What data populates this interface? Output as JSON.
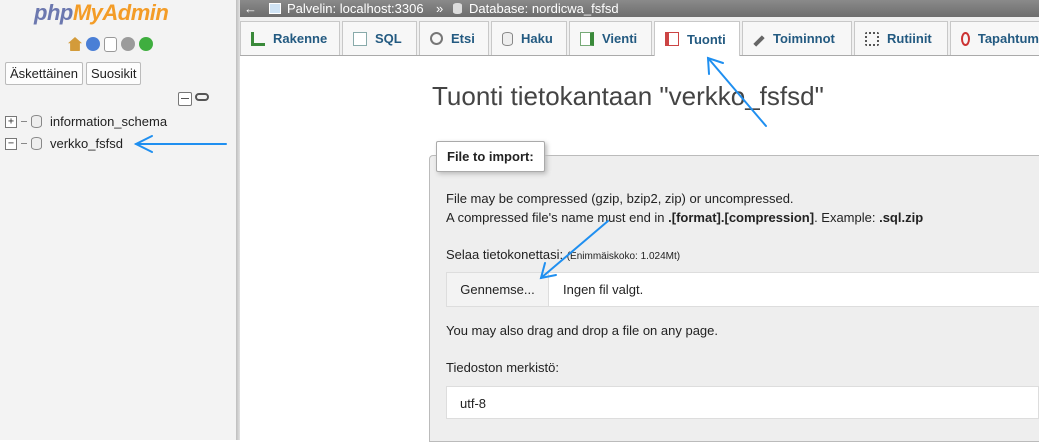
{
  "sidebar": {
    "logo_php": "php",
    "logo_myadmin": "MyAdmin",
    "quick_icons": [
      "home-icon",
      "help-icon",
      "docs-icon",
      "settings-icon",
      "reload-icon"
    ],
    "tabs": [
      {
        "label": "Äskettäinen"
      },
      {
        "label": "Suosikit"
      }
    ],
    "databases": [
      {
        "name": "information_schema",
        "expander": "+"
      },
      {
        "name": "verkko_fsfsd",
        "expander": "−"
      }
    ]
  },
  "topbar": {
    "back_arrow": "←",
    "server": "Palvelin: localhost:3306",
    "separator": "»",
    "database": "Database: nordicwa_fsfsd"
  },
  "tabs": [
    {
      "label": "Rakenne",
      "icon": "structure-icon"
    },
    {
      "label": "SQL",
      "icon": "sql-icon"
    },
    {
      "label": "Etsi",
      "icon": "search-icon"
    },
    {
      "label": "Haku",
      "icon": "query-icon"
    },
    {
      "label": "Vienti",
      "icon": "export-icon"
    },
    {
      "label": "Tuonti",
      "icon": "import-icon",
      "active": true
    },
    {
      "label": "Toiminnot",
      "icon": "operations-icon"
    },
    {
      "label": "Rutiinit",
      "icon": "routines-icon"
    },
    {
      "label": "Tapahtum",
      "icon": "events-icon"
    }
  ],
  "main": {
    "title": "Tuonti tietokantaan \"verkko_fsfsd\"",
    "legend": "File to import:",
    "compress_line1": "File may be compressed (gzip, bzip2, zip) or uncompressed.",
    "compress_line2_pre": "A compressed file's name must end in ",
    "compress_line2_bold1": ".[format].[compression]",
    "compress_line2_mid": ". Example: ",
    "compress_line2_bold2": ".sql.zip",
    "browse_label": "Selaa tietokonettasi: ",
    "max_size": "(Enimmäiskoko: 1.024Mt)",
    "browse_button": "Gennemse...",
    "file_status": "Ingen fil valgt.",
    "drag_drop": "You may also drag and drop a file on any page.",
    "charset_label": "Tiedoston merkistö:",
    "charset_value": "utf-8"
  },
  "colors": {
    "arrow": "#1f8ff0",
    "tab_text": "#235a81",
    "logo_php": "#6c78af",
    "logo_myadmin": "#f39c27"
  }
}
